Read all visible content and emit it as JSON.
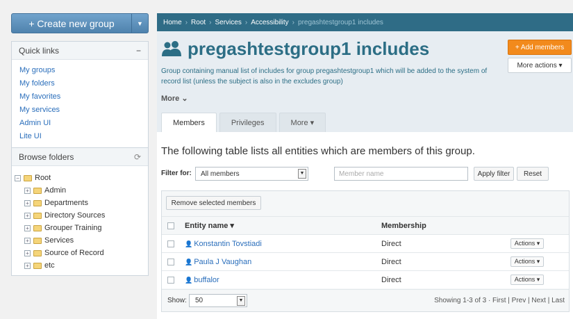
{
  "sidebar": {
    "create_label": "Create new group",
    "create_plus": "+",
    "quick_links_title": "Quick links",
    "quick_links_toggle": "−",
    "quick_links": [
      "My groups",
      "My folders",
      "My favorites",
      "My services",
      "Admin UI",
      "Lite UI"
    ],
    "browse_title": "Browse folders",
    "refresh_glyph": "⟳",
    "tree_root": "Root",
    "tree_children": [
      "Admin",
      "Departments",
      "Directory Sources",
      "Grouper Training",
      "Services",
      "Source of Record",
      "etc"
    ]
  },
  "breadcrumb": {
    "items": [
      "Home",
      "Root",
      "Services",
      "Accessibility"
    ],
    "current": "pregashtestgroup1 includes",
    "sep": "›"
  },
  "header": {
    "title": "pregashtestgroup1 includes",
    "description": "Group containing manual list of includes for group pregashtestgroup1 which will be added to the system of record list (unless the subject is also in the excludes group)",
    "more_label": "More ⌄",
    "add_members_label": "+ Add members",
    "more_actions_label": "More actions ▾",
    "tabs": [
      "Members",
      "Privileges",
      "More ▾"
    ]
  },
  "main": {
    "lead": "The following table lists all entities which are members of this group.",
    "filter_label": "Filter for:",
    "filter_value": "All members",
    "member_placeholder": "Member name",
    "apply_label": "Apply filter",
    "reset_label": "Reset",
    "remove_label": "Remove selected members",
    "columns": {
      "name": "Entity name ▾",
      "membership": "Membership"
    },
    "rows": [
      {
        "name": "Konstantin Tovstiadi",
        "membership": "Direct",
        "actions": "Actions ▾"
      },
      {
        "name": "Paula J Vaughan",
        "membership": "Direct",
        "actions": "Actions ▾"
      },
      {
        "name": "buffalor",
        "membership": "Direct",
        "actions": "Actions ▾"
      }
    ],
    "show_label": "Show:",
    "show_value": "50",
    "paging": "Showing 1-3 of 3 · First | Prev | Next | Last"
  },
  "colors": {
    "brand": "#2f6c86",
    "accent": "#f28a1c",
    "link": "#2a6ebb"
  }
}
